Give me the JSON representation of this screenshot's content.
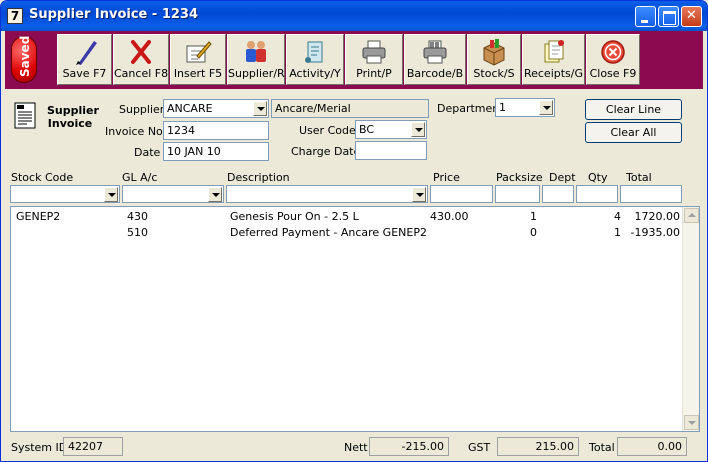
{
  "window": {
    "title": "Supplier Invoice - 1234",
    "app_icon_glyph": "7"
  },
  "toolbar": {
    "saved_badge": "Saved",
    "buttons": [
      {
        "label": "Save F7",
        "icon": "pen-icon"
      },
      {
        "label": "Cancel F8",
        "icon": "cancel-x-icon"
      },
      {
        "label": "Insert F5",
        "icon": "insert-pencil-icon"
      },
      {
        "label": "Supplier/R",
        "icon": "people-icon"
      },
      {
        "label": "Activity/Y",
        "icon": "scroll-icon"
      },
      {
        "label": "Print/P",
        "icon": "printer-icon"
      },
      {
        "label": "Barcode/B",
        "icon": "barcode-printer-icon"
      },
      {
        "label": "Stock/S",
        "icon": "stock-box-icon"
      },
      {
        "label": "Receipts/G",
        "icon": "receipts-icon"
      },
      {
        "label": "Close F9",
        "icon": "close-circle-icon"
      }
    ]
  },
  "form": {
    "title": "Supplier Invoice",
    "supplier_label": "Supplier",
    "supplier_value": "ANCARE",
    "supplier_name": "Ancare/Merial",
    "invoice_label": "Invoice No.",
    "invoice_value": "1234",
    "date_label": "Date",
    "date_value": "10 JAN 10",
    "user_code_label": "User Code",
    "user_code_value": "BC",
    "charge_date_label": "Charge Date",
    "charge_date_value": "",
    "department_label": "Department",
    "department_value": "1",
    "clear_line_label": "Clear Line",
    "clear_all_label": "Clear All"
  },
  "grid": {
    "columns": [
      "Stock Code",
      "GL A/c",
      "Description",
      "Price",
      "Packsize",
      "Dept",
      "Qty",
      "Total"
    ],
    "rows": [
      {
        "stock_code": "GENEP2",
        "gl": "430",
        "description": "Genesis Pour On - 2.5 L",
        "price": "430.00",
        "packsize": "1",
        "dept": "",
        "qty": "4",
        "total": "1720.00"
      },
      {
        "stock_code": "",
        "gl": "510",
        "description": "Deferred Payment - Ancare GENEP2",
        "price": "",
        "packsize": "0",
        "dept": "",
        "qty": "1",
        "total": "-1935.00"
      }
    ]
  },
  "footer": {
    "system_id_label": "System ID",
    "system_id_value": "42207",
    "nett_label": "Nett",
    "nett_value": "-215.00",
    "gst_label": "GST",
    "gst_value": "215.00",
    "total_label": "Total",
    "total_value": "0.00"
  },
  "colors": {
    "toolbar_bg": "#8c0a50",
    "titlebar": "#0a5fe8",
    "window_bg": "#ece9d8"
  }
}
